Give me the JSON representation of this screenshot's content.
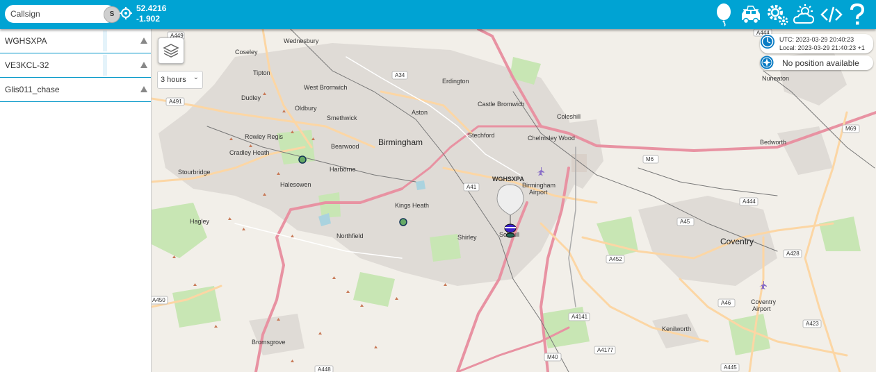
{
  "search": {
    "placeholder": "Callsign",
    "button_label": "S"
  },
  "coordinates": {
    "lat": "52.4216",
    "lon": "-1.902"
  },
  "toolbar_icons": [
    "balloon-icon",
    "car-icon",
    "settings-icon",
    "weather-icon",
    "embed-code-icon",
    "help-icon"
  ],
  "sidebar": {
    "items": [
      {
        "label": "WGHSXPA"
      },
      {
        "label": "VE3KCL-32"
      },
      {
        "label": "Glis011_chase"
      }
    ]
  },
  "map": {
    "history": "3 hours",
    "time": {
      "utc": "UTC: 2023-03-29 20:40:23",
      "local": "Local: 2023-03-29 21:40:23 +1"
    },
    "position_status": "No position available",
    "balloon_label": "WGHSXPA",
    "places": {
      "wednesbury": "Wednesbury",
      "coseley": "Coseley",
      "tipton": "Tipton",
      "west_bromwich": "West Bromwich",
      "dudley": "Dudley",
      "oldbury": "Oldbury",
      "smethwick": "Smethwick",
      "rowley_regis": "Rowley Regis",
      "cradley_heath": "Cradley Heath",
      "bearwood": "Bearwood",
      "stourbridge": "Stourbridge",
      "halesowen": "Halesowen",
      "harborne": "Harborne",
      "birmingham": "Birmingham",
      "aston": "Aston",
      "erdington": "Erdington",
      "castle_bromwich": "Castle Bromwich",
      "stechford": "Stechford",
      "coleshill": "Coleshill",
      "chelmsley_wood": "Chelmsley Wood",
      "birmingham_airport_1": "Birmingham",
      "birmingham_airport_2": "Airport",
      "kings_heath": "Kings Heath",
      "northfield": "Northfield",
      "shirley": "Shirley",
      "solihull": "Solihull",
      "hagley": "Hagley",
      "nuneaton": "Nuneaton",
      "bedworth": "Bedworth",
      "coventry": "Coventry",
      "coventry_airport_1": "Coventry",
      "coventry_airport_2": "Airport",
      "kenilworth": "Kenilworth",
      "bromsgrove": "Bromsgrove"
    },
    "roads": {
      "a449": "A449",
      "a34": "A34",
      "a491": "A491",
      "a41": "A41",
      "a444_top": "A444",
      "m69": "M69",
      "m6": "M6",
      "a444": "A444",
      "a45": "A45",
      "a452": "A452",
      "a428": "A428",
      "a46": "A46",
      "a423": "A423",
      "a450": "A450",
      "a4141": "A4141",
      "a4177": "A4177",
      "m40": "M40",
      "a448": "A448",
      "a445": "A445"
    }
  }
}
